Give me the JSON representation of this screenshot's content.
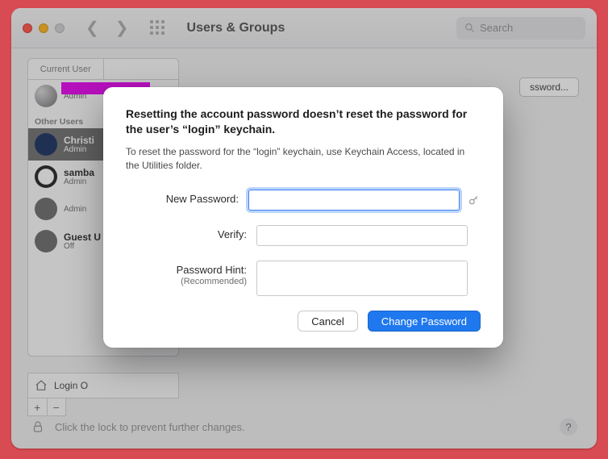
{
  "window": {
    "title": "Users & Groups",
    "search_placeholder": "Search",
    "change_password_btn": "ssword...",
    "lock_hint": "Click the lock to prevent further changes."
  },
  "sidebar": {
    "tab_current": "Current User",
    "section_other": "Other Users",
    "items": [
      {
        "name": "",
        "role": "Admin"
      },
      {
        "name": "Christi",
        "role": "Admin"
      },
      {
        "name": "samba",
        "role": "Admin"
      },
      {
        "name": "",
        "role": "Admin"
      },
      {
        "name": "Guest U",
        "role": "Off"
      }
    ],
    "login_options": "Login O"
  },
  "modal": {
    "heading": "Resetting the account password doesn’t reset the password for the user’s “login” keychain.",
    "body": "To reset the password for the “login” keychain, use Keychain Access, located in the Utilities folder.",
    "labels": {
      "new_password": "New Password:",
      "verify": "Verify:",
      "hint": "Password Hint:",
      "hint_sub": "(Recommended)"
    },
    "buttons": {
      "cancel": "Cancel",
      "primary": "Change Password"
    }
  }
}
